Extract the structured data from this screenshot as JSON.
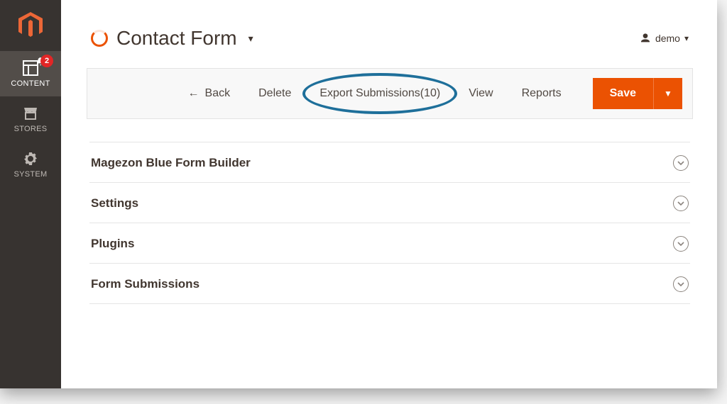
{
  "sidebar": {
    "items": [
      {
        "label": "CONTENT"
      },
      {
        "label": "STORES"
      },
      {
        "label": "SYSTEM"
      }
    ],
    "notification_count": "2"
  },
  "header": {
    "page_title": "Contact Form",
    "user_label": "demo"
  },
  "toolbar": {
    "back_label": "Back",
    "delete_label": "Delete",
    "export_label": "Export Submissions(10)",
    "view_label": "View",
    "reports_label": "Reports",
    "save_label": "Save"
  },
  "sections": [
    {
      "title": "Magezon Blue Form Builder"
    },
    {
      "title": "Settings"
    },
    {
      "title": "Plugins"
    },
    {
      "title": "Form Submissions"
    }
  ]
}
